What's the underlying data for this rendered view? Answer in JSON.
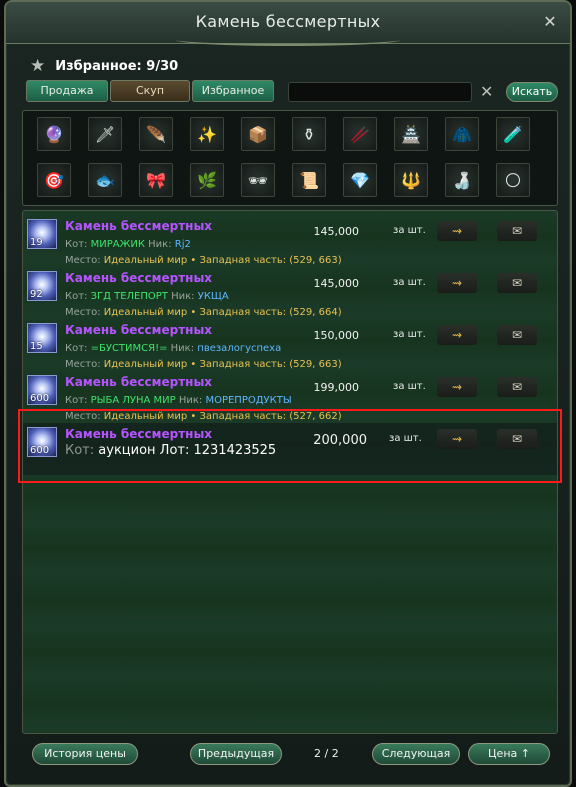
{
  "window": {
    "title": "Камень бессмертных"
  },
  "favorites": {
    "label": "Избранное: 9/30"
  },
  "tabs": [
    {
      "label": "Продажа"
    },
    {
      "label": "Скуп"
    },
    {
      "label": "Избранное"
    }
  ],
  "search": {
    "value": "",
    "button_label": "Искать"
  },
  "categories": [
    "🔮",
    "🗡",
    "🪶",
    "✨",
    "📦",
    "⚱",
    "🥢",
    "🏯",
    "🧥",
    "🧪",
    "🎯",
    "🐟",
    "🎀",
    "🌿",
    "🕶",
    "📜",
    "💎",
    "🔱",
    "🍶",
    "🌕"
  ],
  "listing": {
    "labels": {
      "seller": "Кот:",
      "nick": "Ник:",
      "place": "Место:",
      "per_unit": "за шт."
    },
    "rows": [
      {
        "qty": "19",
        "name": "Камень бессмертных",
        "seller": "МИРАЖИК",
        "nick": "Rj2",
        "place": "Идеальный мир • Западная часть: (529, 663)",
        "price": "145,000"
      },
      {
        "qty": "92",
        "name": "Камень бессмертных",
        "seller": "ЗГД ТЕЛЕПОРТ",
        "nick": "УКЩА",
        "place": "Идеальный мир • Западная часть: (529, 664)",
        "price": "145,000"
      },
      {
        "qty": "15",
        "name": "Камень бессмертных",
        "seller": "=БУСТИМСЯ!=",
        "nick": "пвезалогуспеха",
        "place": "Идеальный мир • Западная часть: (529, 663)",
        "price": "150,000"
      },
      {
        "qty": "600",
        "name": "Камень бессмертных",
        "seller": "РЫБА ЛУНА МИР",
        "nick": "МОРЕПРОДУКТЫ",
        "place": "Идеальный мир • Западная часть: (527, 662)",
        "price": "199,000"
      }
    ],
    "highlighted": {
      "qty": "600",
      "name": "Камень бессмертных",
      "seller_prefix": "Кот:",
      "info": "аукцион Лот: 1231423525",
      "price": "200,000",
      "per_unit": "за шт."
    }
  },
  "footer": {
    "history_label": "История цены",
    "prev_label": "Предыдущая",
    "page": "2 / 2",
    "next_label": "Следующая",
    "sort_label": "Цена ↑"
  }
}
